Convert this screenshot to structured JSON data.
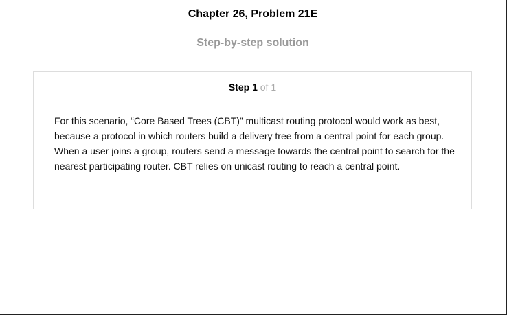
{
  "header": {
    "title": "Chapter 26, Problem 21E",
    "subtitle": "Step-by-step solution"
  },
  "step": {
    "label": "Step 1",
    "of_text": "of 1",
    "text": "For this scenario, “Core Based Trees (CBT)” multicast routing protocol would work as best, because a protocol in which routers build a delivery tree from a central point for each group. When a user joins a group, routers send a message towards the central point to search for the nearest participating router. CBT relies on unicast routing to reach a central point."
  },
  "colors": {
    "subtitle": "#9a9a9a",
    "step_of": "#aaaaaa",
    "card_border": "#dddddd"
  }
}
